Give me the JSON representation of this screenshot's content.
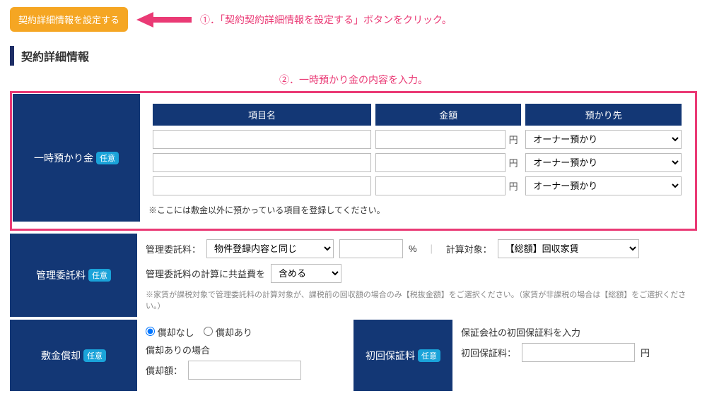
{
  "top": {
    "button": "契約詳細情報を設定する",
    "anno1": "①．「契約契約詳細情報を設定する」ボタンをクリック。"
  },
  "section_title": "契約詳細情報",
  "anno2": "②．一時預かり金の内容を入力。",
  "deposit": {
    "sidebar": "一時預かり金",
    "badge": "任意",
    "headers": {
      "item": "項目名",
      "amount": "金額",
      "keeper": "預かり先"
    },
    "yen": "円",
    "keeper_option": "オーナー預かり",
    "note": "※ここには敷金以外に預かっている項目を登録してください。"
  },
  "fee": {
    "sidebar": "管理委託料",
    "badge": "任意",
    "label1": "管理委託料：",
    "select1": "物件登録内容と同じ",
    "pct": "%",
    "sep": "｜",
    "label2": "計算対象：",
    "select2": "【総額】回収家賃",
    "label3": "管理委託料の計算に共益費を",
    "select3": "含める",
    "fine": "※家賃が課税対象で管理委託料の計算対象が、課税前の回収額の場合のみ【税抜金額】をご選択ください。（家賃が非課税の場合は【総額】をご選択ください。）"
  },
  "amort": {
    "sidebar": "敷金償却",
    "badge": "任意",
    "radio_none": "償却なし",
    "radio_some": "償却あり",
    "label1": "償却ありの場合",
    "label2": "償却額："
  },
  "firstfee": {
    "sidebar": "初回保証料",
    "badge": "任意",
    "label1": "保証会社の初回保証料を入力",
    "label2": "初回保証料：",
    "yen": "円"
  }
}
